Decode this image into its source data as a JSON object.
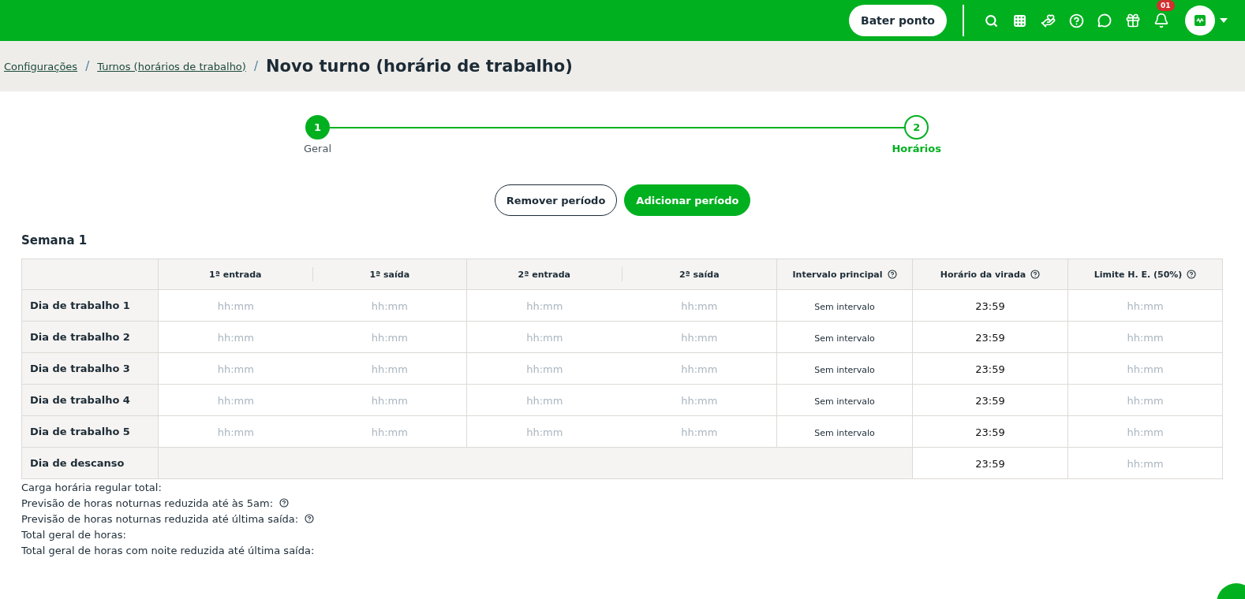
{
  "topbar": {
    "punch_button": "Bater ponto",
    "notification_count": "01"
  },
  "breadcrumb": {
    "links": [
      {
        "label": "Configurações",
        "separator": "/"
      },
      {
        "label": "Turnos (horários de trabalho)",
        "separator": "/"
      }
    ],
    "title": "Novo turno (horário de trabalho)"
  },
  "steps": [
    {
      "number": "1",
      "label": "Geral",
      "selected": false
    },
    {
      "number": "2",
      "label": "Horários",
      "selected": true
    }
  ],
  "actions": [
    {
      "label": "Remover período",
      "kind": "outline"
    },
    {
      "label": "Adicionar período",
      "kind": "primary"
    }
  ],
  "week": {
    "title": "Semana 1",
    "columns": [
      {
        "label": "1ª entrada",
        "help": false
      },
      {
        "label": "1ª saída",
        "help": false
      },
      {
        "label": "2ª entrada",
        "help": false
      },
      {
        "label": "2ª saída",
        "help": false
      },
      {
        "label": "Intervalo principal",
        "help": true
      },
      {
        "label": "Horário da virada",
        "help": true
      },
      {
        "label": "Limite H. E. (50%)",
        "help": true
      }
    ],
    "rows": [
      {
        "kind": "work",
        "label": "Dia de trabalho 1",
        "time_placeholders": [
          "hh:mm",
          "hh:mm",
          "hh:mm",
          "hh:mm"
        ],
        "interval": "Sem intervalo",
        "turnover": "23:59",
        "limit_placeholder": "hh:mm"
      },
      {
        "kind": "work",
        "label": "Dia de trabalho 2",
        "time_placeholders": [
          "hh:mm",
          "hh:mm",
          "hh:mm",
          "hh:mm"
        ],
        "interval": "Sem intervalo",
        "turnover": "23:59",
        "limit_placeholder": "hh:mm"
      },
      {
        "kind": "work",
        "label": "Dia de trabalho 3",
        "time_placeholders": [
          "hh:mm",
          "hh:mm",
          "hh:mm",
          "hh:mm"
        ],
        "interval": "Sem intervalo",
        "turnover": "23:59",
        "limit_placeholder": "hh:mm"
      },
      {
        "kind": "work",
        "label": "Dia de trabalho 4",
        "time_placeholders": [
          "hh:mm",
          "hh:mm",
          "hh:mm",
          "hh:mm"
        ],
        "interval": "Sem intervalo",
        "turnover": "23:59",
        "limit_placeholder": "hh:mm"
      },
      {
        "kind": "work",
        "label": "Dia de trabalho 5",
        "time_placeholders": [
          "hh:mm",
          "hh:mm",
          "hh:mm",
          "hh:mm"
        ],
        "interval": "Sem intervalo",
        "turnover": "23:59",
        "limit_placeholder": "hh:mm"
      },
      {
        "kind": "rest",
        "label": "Dia de descanso",
        "turnover": "23:59",
        "limit_placeholder": "hh:mm"
      }
    ]
  },
  "summary": [
    {
      "label": "Carga horária regular total:",
      "help": false
    },
    {
      "label": "Previsão de horas noturnas reduzida até às 5am:",
      "help": true
    },
    {
      "label": "Previsão de horas noturnas reduzida até última saída:",
      "help": true
    },
    {
      "label": "Total geral de horas:",
      "help": false
    },
    {
      "label": "Total geral de horas com noite reduzida até última saída:",
      "help": false
    }
  ]
}
